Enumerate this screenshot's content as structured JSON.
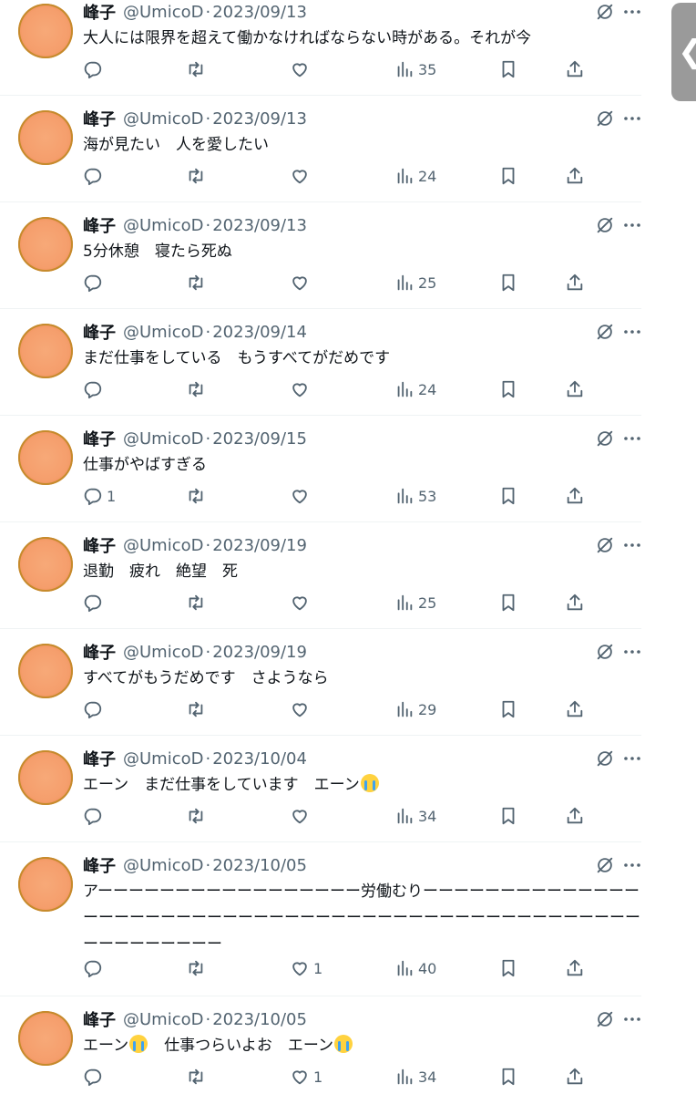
{
  "colors": {
    "text": "#0f1419",
    "muted": "#536471",
    "divider": "#eff3f4",
    "avatar": "#f59e6c"
  },
  "tweets": [
    {
      "name": "峰子",
      "handle": "@UmicoD",
      "sep": "·",
      "date": "2023/09/13",
      "text": "大人には限界を超えて働かなければならない時がある。それが今",
      "replies": "",
      "likes": "",
      "views": "35"
    },
    {
      "name": "峰子",
      "handle": "@UmicoD",
      "sep": "·",
      "date": "2023/09/13",
      "text": "海が見たい　人を愛したい",
      "replies": "",
      "likes": "",
      "views": "24"
    },
    {
      "name": "峰子",
      "handle": "@UmicoD",
      "sep": "·",
      "date": "2023/09/13",
      "text": "5分休憩　寝たら死ぬ",
      "replies": "",
      "likes": "",
      "views": "25"
    },
    {
      "name": "峰子",
      "handle": "@UmicoD",
      "sep": "·",
      "date": "2023/09/14",
      "text": "まだ仕事をしている　もうすべてがだめです",
      "replies": "",
      "likes": "",
      "views": "24"
    },
    {
      "name": "峰子",
      "handle": "@UmicoD",
      "sep": "·",
      "date": "2023/09/15",
      "text": "仕事がやばすぎる",
      "replies": "1",
      "likes": "",
      "views": "53"
    },
    {
      "name": "峰子",
      "handle": "@UmicoD",
      "sep": "·",
      "date": "2023/09/19",
      "text": "退勤　疲れ　絶望　死",
      "replies": "",
      "likes": "",
      "views": "25"
    },
    {
      "name": "峰子",
      "handle": "@UmicoD",
      "sep": "·",
      "date": "2023/09/19",
      "text": "すべてがもうだめです　さようなら",
      "replies": "",
      "likes": "",
      "views": "29"
    },
    {
      "name": "峰子",
      "handle": "@UmicoD",
      "sep": "·",
      "date": "2023/10/04",
      "text": "エーン　まだ仕事をしています　エーン😭",
      "replies": "",
      "likes": "",
      "views": "34"
    },
    {
      "name": "峰子",
      "handle": "@UmicoD",
      "sep": "·",
      "date": "2023/10/05",
      "text": "アーーーーーーーーーーーーーーーーー労働むりーーーーーーーーーーーーーーーーーーーーーーーーーーーーーーーーーーーーーーーーーーーーーーーーーーーーーーーーーーー",
      "replies": "",
      "likes": "1",
      "views": "40"
    },
    {
      "name": "峰子",
      "handle": "@UmicoD",
      "sep": "·",
      "date": "2023/10/05",
      "text": "エーン😭　仕事つらいよお　エーン😭",
      "replies": "",
      "likes": "1",
      "views": "34"
    }
  ],
  "side_tab": {
    "glyph": "❮"
  }
}
